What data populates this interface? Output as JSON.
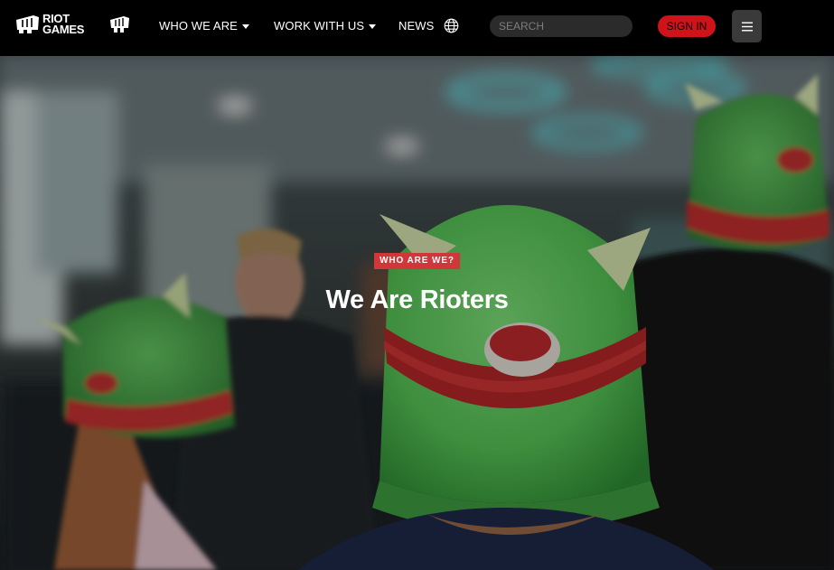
{
  "brand": {
    "logo_line1": "RIOT",
    "logo_line2": "GAMES"
  },
  "nav": {
    "items": [
      {
        "label": "WHO WE ARE",
        "has_dropdown": true
      },
      {
        "label": "WORK WITH US",
        "has_dropdown": true
      },
      {
        "label": "NEWS",
        "has_dropdown": false
      }
    ],
    "language_icon": "globe-icon",
    "search_placeholder": "SEARCH",
    "sign_in_label": "SIGN IN",
    "menu_icon": "hamburger-icon"
  },
  "hero": {
    "eyebrow": "WHO ARE WE?",
    "title": "We Are Rioters"
  },
  "colors": {
    "nav_background": "#000000",
    "accent_red": "#d0121b",
    "eyebrow_red": "#d13639",
    "text_white": "#ffffff"
  }
}
